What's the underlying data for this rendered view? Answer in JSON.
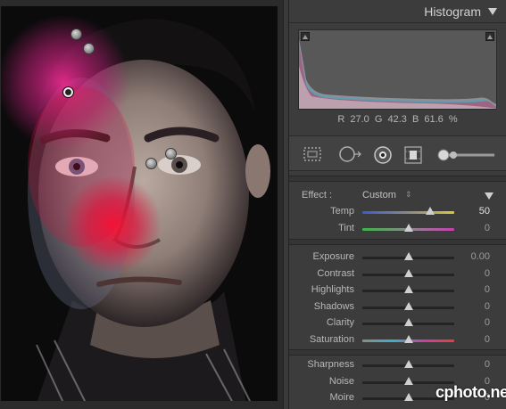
{
  "histogram": {
    "title": "Histogram",
    "readout": {
      "r_label": "R",
      "r": "27.0",
      "g_label": "G",
      "g": "42.3",
      "b_label": "B",
      "b": "61.6",
      "unit": "%"
    }
  },
  "effect": {
    "label": "Effect :",
    "preset": "Custom",
    "preset_arrow": "⇕"
  },
  "group1": [
    {
      "label": "Temp",
      "value": "50",
      "position": 0.74,
      "track": "temp"
    },
    {
      "label": "Tint",
      "value": "0",
      "position": 0.5,
      "track": "tint"
    }
  ],
  "group2": [
    {
      "label": "Exposure",
      "value": "0.00",
      "position": 0.5,
      "track": "plain"
    },
    {
      "label": "Contrast",
      "value": "0",
      "position": 0.5,
      "track": "plain"
    },
    {
      "label": "Highlights",
      "value": "0",
      "position": 0.5,
      "track": "plain"
    },
    {
      "label": "Shadows",
      "value": "0",
      "position": 0.5,
      "track": "plain"
    },
    {
      "label": "Clarity",
      "value": "0",
      "position": 0.5,
      "track": "plain"
    },
    {
      "label": "Saturation",
      "value": "0",
      "position": 0.5,
      "track": "saturation"
    }
  ],
  "group3": [
    {
      "label": "Sharpness",
      "value": "0",
      "position": 0.5,
      "track": "plain"
    },
    {
      "label": "Noise",
      "value": "0",
      "position": 0.5,
      "track": "plain"
    },
    {
      "label": "Moire",
      "value": "0",
      "position": 0.5,
      "track": "plain"
    }
  ],
  "watermark": "cphoto.net",
  "colors": {
    "panel": "#3c3c3c",
    "overlay_red": "#e0103a",
    "overlay_magenta": "#d0208a"
  }
}
